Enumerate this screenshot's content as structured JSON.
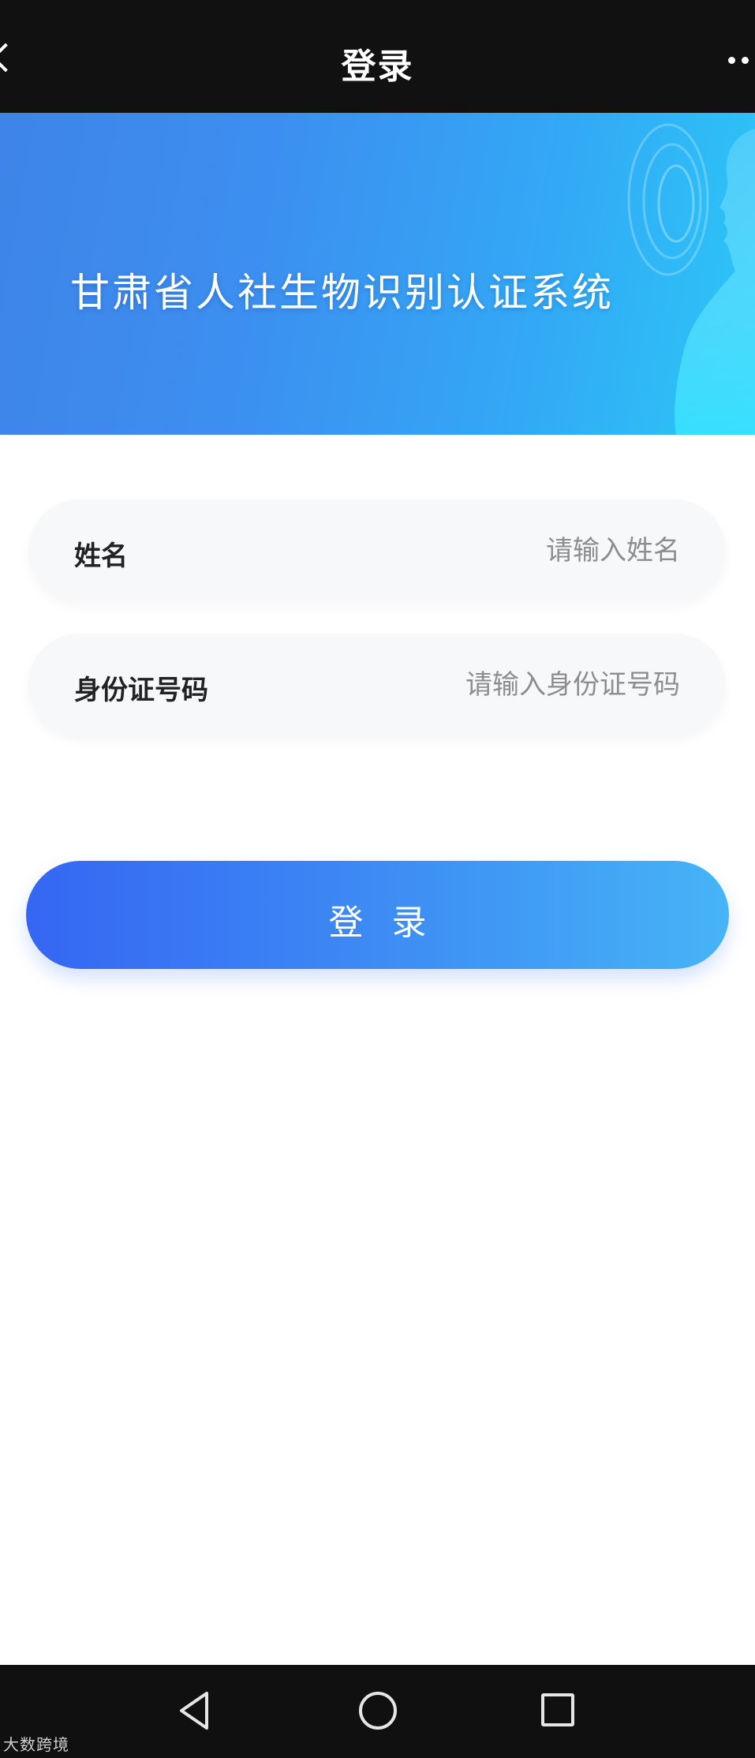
{
  "topbar": {
    "title": "登录",
    "back_icon": "back-arrow-icon",
    "more_icon": "more-dots-icon"
  },
  "banner": {
    "title": "甘肃省人社生物识别认证系统",
    "colors": {
      "start": "#3f84e8",
      "end": "#2cc7f7"
    }
  },
  "form": {
    "fields": [
      {
        "label": "姓名",
        "placeholder": "请输入姓名",
        "value": ""
      },
      {
        "label": "身份证号码",
        "placeholder": "请输入身份证号码",
        "value": ""
      }
    ],
    "submit_label": "登录"
  },
  "navbar": {
    "icons": [
      "nav-back-icon",
      "nav-home-icon",
      "nav-recent-apps-icon"
    ]
  },
  "watermark": "大数跨境",
  "colors": {
    "topbar_bg": "#111111",
    "button_start": "#3566f3",
    "button_end": "#46b4f6",
    "field_bg": "#f7f8fa"
  }
}
